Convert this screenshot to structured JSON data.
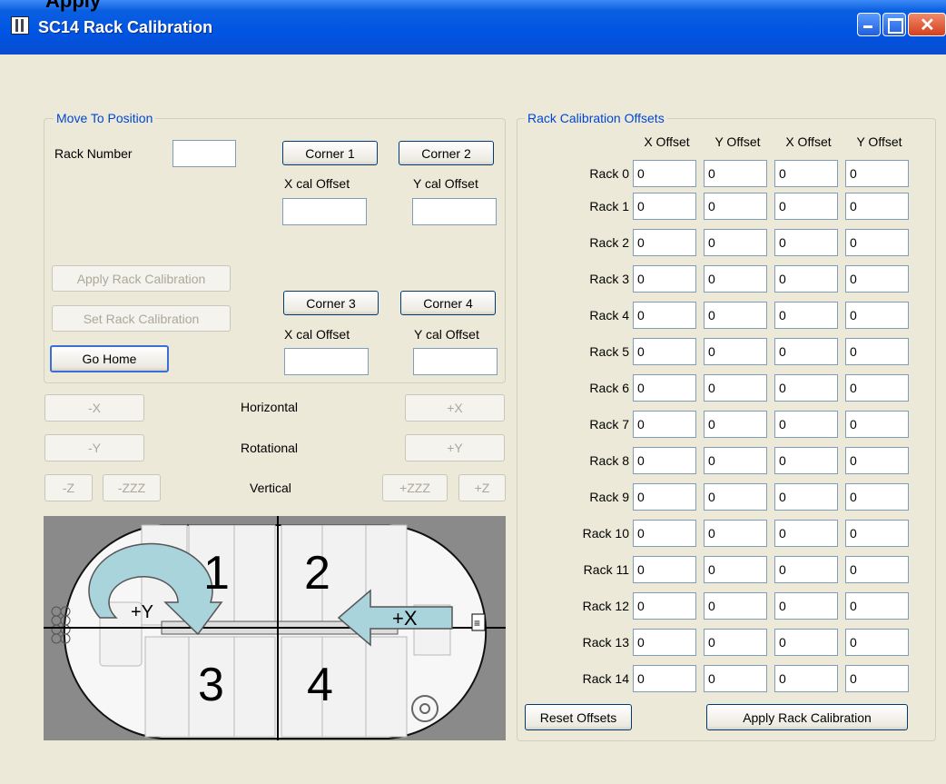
{
  "top_text": "Apply",
  "window": {
    "title": "SC14 Rack Calibration",
    "controls": {
      "minimize": "minimize-icon",
      "maximize": "maximize-icon",
      "close": "close-icon"
    }
  },
  "move_group": {
    "title": "Move To Position",
    "rack_number_label": "Rack Number",
    "rack_number_value": "",
    "corner1": "Corner 1",
    "corner2": "Corner 2",
    "corner3": "Corner 3",
    "corner4": "Corner 4",
    "x_cal_offset": "X cal Offset",
    "y_cal_offset": "Y cal Offset",
    "x_cal_value_top": "",
    "y_cal_value_top": "",
    "x_cal_value_bottom": "",
    "y_cal_value_bottom": "",
    "apply_rack_calibration": "Apply Rack Calibration",
    "set_rack_calibration": "Set Rack Calibration",
    "go_home": "Go Home"
  },
  "jog": {
    "minus_x": "-X",
    "plus_x": "+X",
    "horizontal": "Horizontal",
    "minus_y": "-Y",
    "plus_y": "+Y",
    "rotational": "Rotational",
    "minus_z": "-Z",
    "minus_zzz": "-ZZZ",
    "vertical": "Vertical",
    "plus_zzz": "+ZZZ",
    "plus_z": "+Z"
  },
  "diagram": {
    "quadrants": [
      "1",
      "2",
      "3",
      "4"
    ],
    "arrow_y": "+Y",
    "arrow_x": "+X"
  },
  "offsets_group": {
    "title": "Rack Calibration Offsets",
    "headers": [
      "X Offset",
      "Y Offset",
      "X Offset",
      "Y Offset"
    ],
    "racks": [
      {
        "label": "Rack 0",
        "values": [
          "0",
          "0",
          "0",
          "0"
        ]
      },
      {
        "label": "Rack 1",
        "values": [
          "0",
          "0",
          "0",
          "0"
        ]
      },
      {
        "label": "Rack 2",
        "values": [
          "0",
          "0",
          "0",
          "0"
        ]
      },
      {
        "label": "Rack 3",
        "values": [
          "0",
          "0",
          "0",
          "0"
        ]
      },
      {
        "label": "Rack 4",
        "values": [
          "0",
          "0",
          "0",
          "0"
        ]
      },
      {
        "label": "Rack 5",
        "values": [
          "0",
          "0",
          "0",
          "0"
        ]
      },
      {
        "label": "Rack 6",
        "values": [
          "0",
          "0",
          "0",
          "0"
        ]
      },
      {
        "label": "Rack 7",
        "values": [
          "0",
          "0",
          "0",
          "0"
        ]
      },
      {
        "label": "Rack 8",
        "values": [
          "0",
          "0",
          "0",
          "0"
        ]
      },
      {
        "label": "Rack 9",
        "values": [
          "0",
          "0",
          "0",
          "0"
        ]
      },
      {
        "label": "Rack 10",
        "values": [
          "0",
          "0",
          "0",
          "0"
        ]
      },
      {
        "label": "Rack 11",
        "values": [
          "0",
          "0",
          "0",
          "0"
        ]
      },
      {
        "label": "Rack 12",
        "values": [
          "0",
          "0",
          "0",
          "0"
        ]
      },
      {
        "label": "Rack 13",
        "values": [
          "0",
          "0",
          "0",
          "0"
        ]
      },
      {
        "label": "Rack 14",
        "values": [
          "0",
          "0",
          "0",
          "0"
        ]
      }
    ],
    "reset_offsets": "Reset Offsets",
    "apply_rack_calibration": "Apply Rack Calibration"
  },
  "colors": {
    "titlebar": "#0054e3",
    "group_title": "#0046d5",
    "arrow": "#a9d4dc"
  }
}
